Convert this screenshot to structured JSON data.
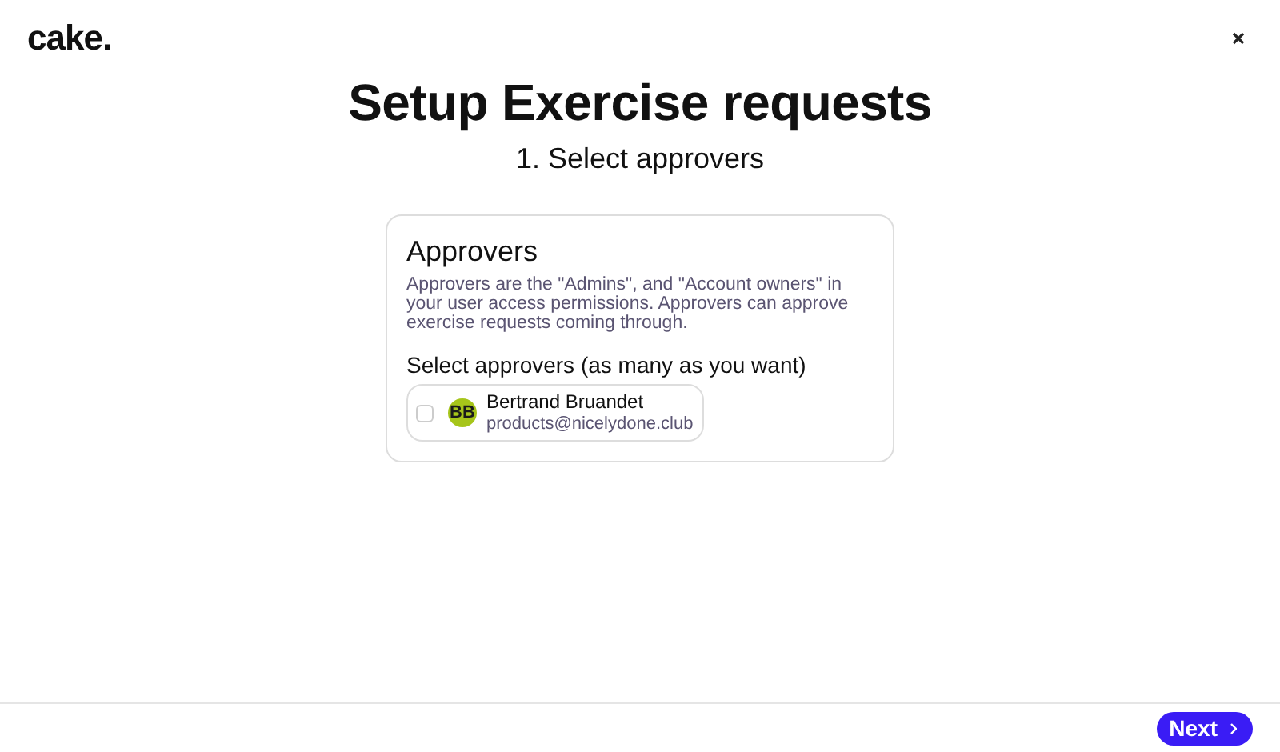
{
  "logo": "cake.",
  "title": "Setup Exercise requests",
  "step": "1. Select approvers",
  "card": {
    "heading": "Approvers",
    "description": "Approvers are the \"Admins\", and \"Account owners\" in your user access permissions. Approvers can approve exercise requests coming through.",
    "prompt": "Select approvers (as many as you want)",
    "approvers": [
      {
        "initials": "BB",
        "name": "Bertrand Bruandet",
        "email": "products@nicelydone.club",
        "checked": false,
        "color": "#a6c51a"
      }
    ]
  },
  "footer": {
    "next_button": "Next"
  }
}
